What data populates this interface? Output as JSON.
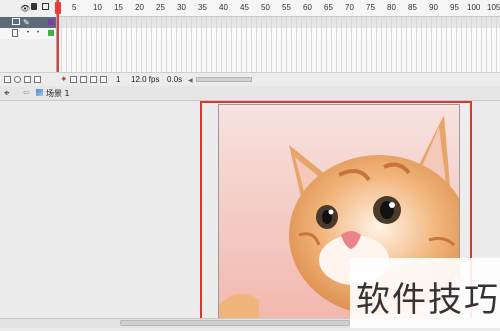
{
  "timeline": {
    "ruler_labels": [
      "5",
      "10",
      "15",
      "20",
      "25",
      "30",
      "35",
      "40",
      "45",
      "50",
      "55",
      "60",
      "65",
      "70",
      "75",
      "80",
      "85",
      "90",
      "95",
      "100",
      "105"
    ],
    "layers": [
      {
        "icon": "layer-folder-icon",
        "selected": true
      },
      {
        "icon": "layer-icon",
        "selected": false
      }
    ],
    "footer": {
      "current_frame": "1",
      "frame_rate": "12.0 fps",
      "elapsed_time": "0.0s"
    }
  },
  "editbar": {
    "scene_label": "场景 1"
  },
  "stage": {
    "selection_color": "#d9362f"
  },
  "watermark": {
    "text": "软件技巧"
  }
}
